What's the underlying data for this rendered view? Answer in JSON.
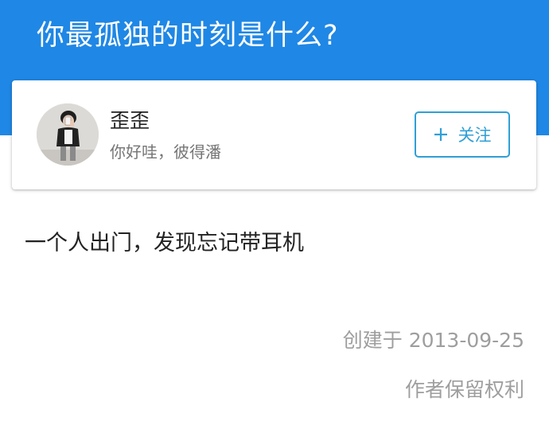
{
  "question": {
    "title": "你最孤独的时刻是什么?"
  },
  "author": {
    "name": "歪歪",
    "bio": "你好哇，彼得潘",
    "avatar_icon": "avatar-photo-icon",
    "follow_button": {
      "icon": "plus-icon",
      "label": "关注"
    }
  },
  "answer": {
    "text": "一个人出门，发现忘记带耳机"
  },
  "footer": {
    "created": "创建于 2013-09-25",
    "copyright": "作者保留权利"
  },
  "colors": {
    "header_blue": "#1f87e5",
    "follow_blue": "#2f9fd6",
    "meta_gray": "#9e9e9e"
  }
}
